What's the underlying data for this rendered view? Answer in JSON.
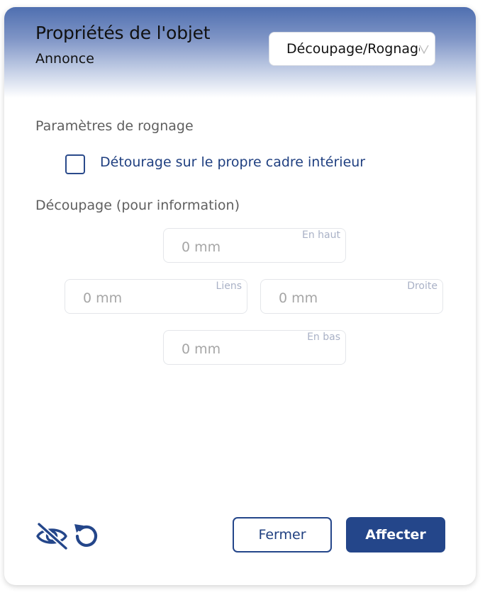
{
  "header": {
    "title": "Propriétés de l'objet",
    "subtitle": "Annonce",
    "mode_select": {
      "value": "Découpage/Rognage",
      "icon": "chevron-down-icon"
    }
  },
  "crop_settings": {
    "section_label": "Paramètres de rognage",
    "clip_checkbox": {
      "label": "Détourage sur le propre cadre intérieur",
      "checked": false
    }
  },
  "trim": {
    "section_label": "Découpage (pour information)",
    "fields": {
      "top": {
        "label": "En haut",
        "placeholder": "0 mm"
      },
      "left": {
        "label": "Liens",
        "placeholder": "0 mm"
      },
      "right": {
        "label": "Droite",
        "placeholder": "0 mm"
      },
      "bottom": {
        "label": "En bas",
        "placeholder": "0 mm"
      }
    }
  },
  "footer": {
    "icons": [
      "eye-slash-icon",
      "reset-icon"
    ],
    "close_label": "Fermer",
    "apply_label": "Affecter"
  },
  "colors": {
    "accent": "#24468a",
    "header_gradient_top": "#4f6fb0",
    "muted_text": "#a6a6a6"
  }
}
